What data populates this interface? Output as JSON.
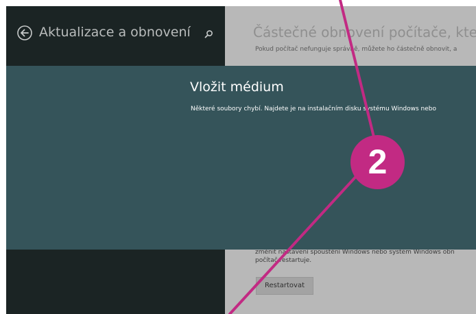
{
  "sidebar": {
    "back_icon": "back-arrow-icon",
    "title": "Aktualizace a obnovení",
    "search_icon": "search-icon"
  },
  "main": {
    "title": "Částečné obnovení počítače, které n",
    "description": "Pokud počítač nefunguje správně, můžete ho částečně obnovit, a",
    "bottom_lines": [
      "změnit nastavení spouštění Windows nebo systém Windows obn",
      "počítač restartuje."
    ],
    "restart_label": "Restartovat"
  },
  "dialog": {
    "title": "Vložit médium",
    "text": "Některé soubory chybí. Najdete je na instalačním disku systému Windows nebo"
  },
  "annotation": {
    "callout_number": "2",
    "color": "#c22a83"
  },
  "colors": {
    "sidebar_bg": "#1b2424",
    "dialog_bg": "#35545a",
    "main_bg": "#b8b8b8"
  }
}
